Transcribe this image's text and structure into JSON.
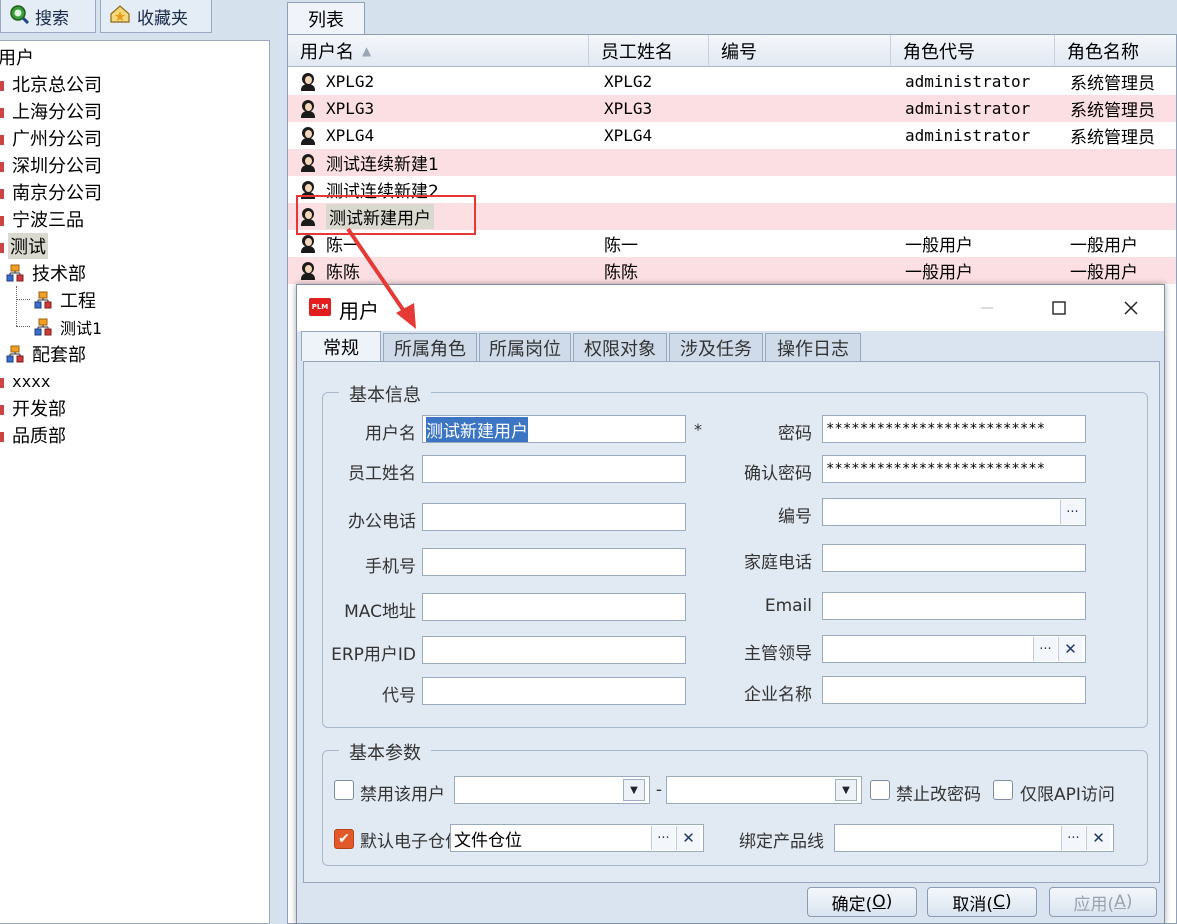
{
  "left": {
    "tabs": [
      {
        "label": "搜索"
      },
      {
        "label": "收藏夹"
      }
    ],
    "tree": {
      "root": "用户",
      "nodes": [
        "北京总公司",
        "上海分公司",
        "广州分公司",
        "深圳分公司",
        "南京分公司",
        "宁波三品",
        "测试",
        "技术部",
        "工程",
        "测试1",
        "配套部",
        "xxxx",
        "开发部",
        "品质部"
      ]
    }
  },
  "list": {
    "tab": "列表",
    "columns": [
      "用户名",
      "员工姓名",
      "编号",
      "角色代号",
      "角色名称"
    ],
    "rows": [
      {
        "username": "XPLG2",
        "employee": "XPLG2",
        "code": "",
        "role_code": "administrator",
        "role_name": "系统管理员"
      },
      {
        "username": "XPLG3",
        "employee": "XPLG3",
        "code": "",
        "role_code": "administrator",
        "role_name": "系统管理员"
      },
      {
        "username": "XPLG4",
        "employee": "XPLG4",
        "code": "",
        "role_code": "administrator",
        "role_name": "系统管理员"
      },
      {
        "username": "测试连续新建1",
        "employee": "",
        "code": "",
        "role_code": "",
        "role_name": ""
      },
      {
        "username": "测试连续新建2",
        "employee": "",
        "code": "",
        "role_code": "",
        "role_name": ""
      },
      {
        "username": "测试新建用户",
        "employee": "",
        "code": "",
        "role_code": "",
        "role_name": ""
      },
      {
        "username": "陈一",
        "employee": "陈一",
        "code": "",
        "role_code": "一般用户",
        "role_name": "一般用户"
      },
      {
        "username": "陈陈",
        "employee": "陈陈",
        "code": "",
        "role_code": "一般用户",
        "role_name": "一般用户"
      }
    ]
  },
  "dialog": {
    "logo": "PLM",
    "title": "用户",
    "tabs": [
      "常规",
      "所属角色",
      "所属岗位",
      "权限对象",
      "涉及任务",
      "操作日志"
    ],
    "basic_info": {
      "legend": "基本信息",
      "username_label": "用户名",
      "username_value": "测试新建用户",
      "required_mark": "*",
      "password_label": "密码",
      "password_value": "**************************",
      "employee_label": "员工姓名",
      "employee_value": "",
      "confirm_label": "确认密码",
      "confirm_value": "**************************",
      "office_phone_label": "办公电话",
      "office_phone_value": "",
      "code_label": "编号",
      "code_value": "",
      "mobile_label": "手机号",
      "mobile_value": "",
      "home_phone_label": "家庭电话",
      "home_phone_value": "",
      "mac_label": "MAC地址",
      "mac_value": "",
      "email_label": "Email",
      "email_value": "",
      "erp_label": "ERP用户ID",
      "erp_value": "",
      "leader_label": "主管领导",
      "leader_value": "",
      "alias_label": "代号",
      "alias_value": "",
      "company_label": "企业名称",
      "company_value": ""
    },
    "basic_params": {
      "legend": "基本参数",
      "disable_user_label": "禁用该用户",
      "date_separator": "-",
      "no_change_pw_label": "禁止改密码",
      "api_only_label": "仅限API访问",
      "default_esign_label": "默认电子仓位",
      "default_esign_value": "文件仓位",
      "product_line_label": "绑定产品线",
      "product_line_value": ""
    },
    "buttons": {
      "ok": "确定(",
      "ok_key": "O",
      "cancel": "取消(",
      "cancel_key": "C",
      "apply": "应用(",
      "apply_key": "A",
      "close_paren": ")"
    },
    "ellipsis": "···",
    "clear": "✕"
  },
  "colors": {
    "row_pink": "#fbdfe2",
    "highlight": "#e53935",
    "accent_red": "#e11d1d"
  }
}
